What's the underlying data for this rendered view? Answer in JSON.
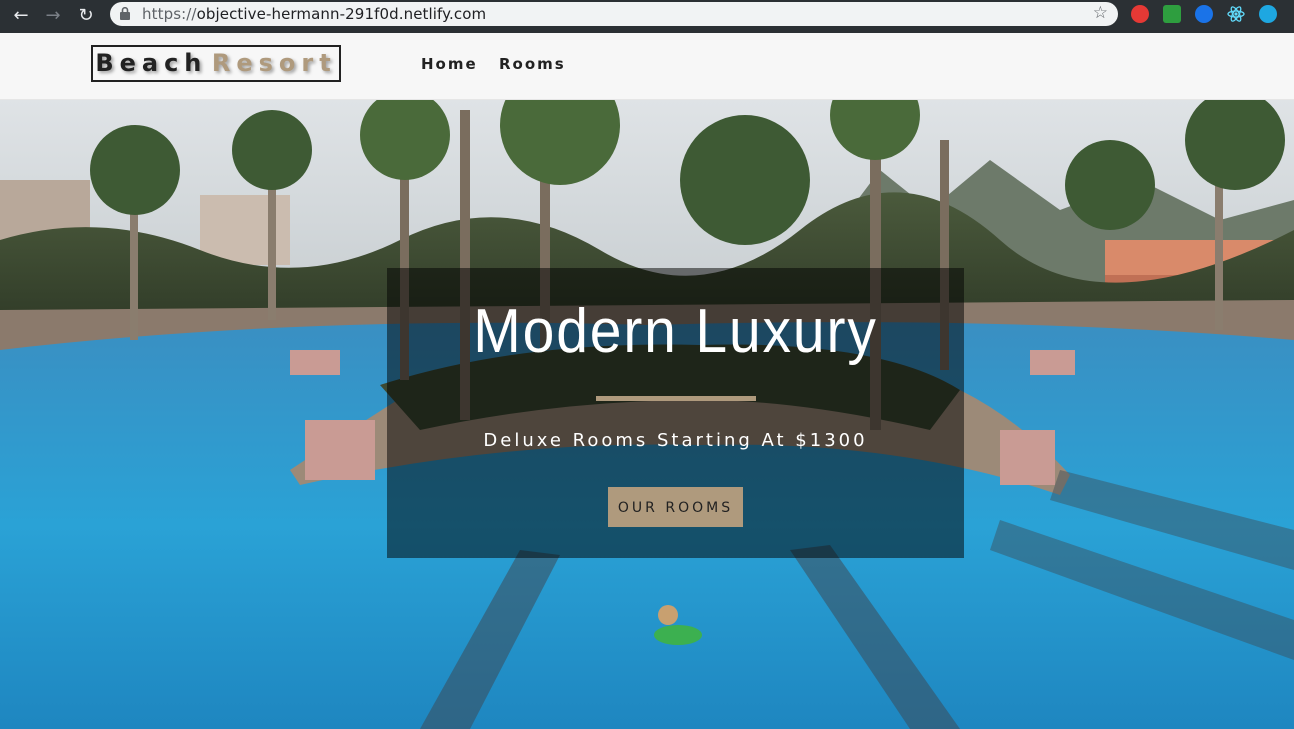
{
  "browser": {
    "url_scheme": "https://",
    "url_host": "objective-hermann-291f0d.netlify.com",
    "back_icon": "arrow-left",
    "forward_icon": "arrow-right",
    "reload_icon": "reload",
    "star_icon": "star-outline",
    "extensions": [
      {
        "name": "red-extension-icon",
        "color": "#e53935"
      },
      {
        "name": "green-extension-icon",
        "color": "#2e9e3f"
      },
      {
        "name": "blue-extension-icon",
        "color": "#1a73e8"
      },
      {
        "name": "react-extension-icon",
        "color": "#61dafb"
      },
      {
        "name": "cyan-extension-icon",
        "color": "#1ea7e1"
      }
    ]
  },
  "site": {
    "logo_word1": "Beach",
    "logo_word2": "Resort",
    "nav": [
      {
        "label": "Home"
      },
      {
        "label": "Rooms"
      }
    ],
    "accent_color": "#af9a7d"
  },
  "hero": {
    "title": "Modern Luxury",
    "subtitle": "Deluxe Rooms Starting At $1300",
    "button_label": "OUR ROOMS"
  }
}
